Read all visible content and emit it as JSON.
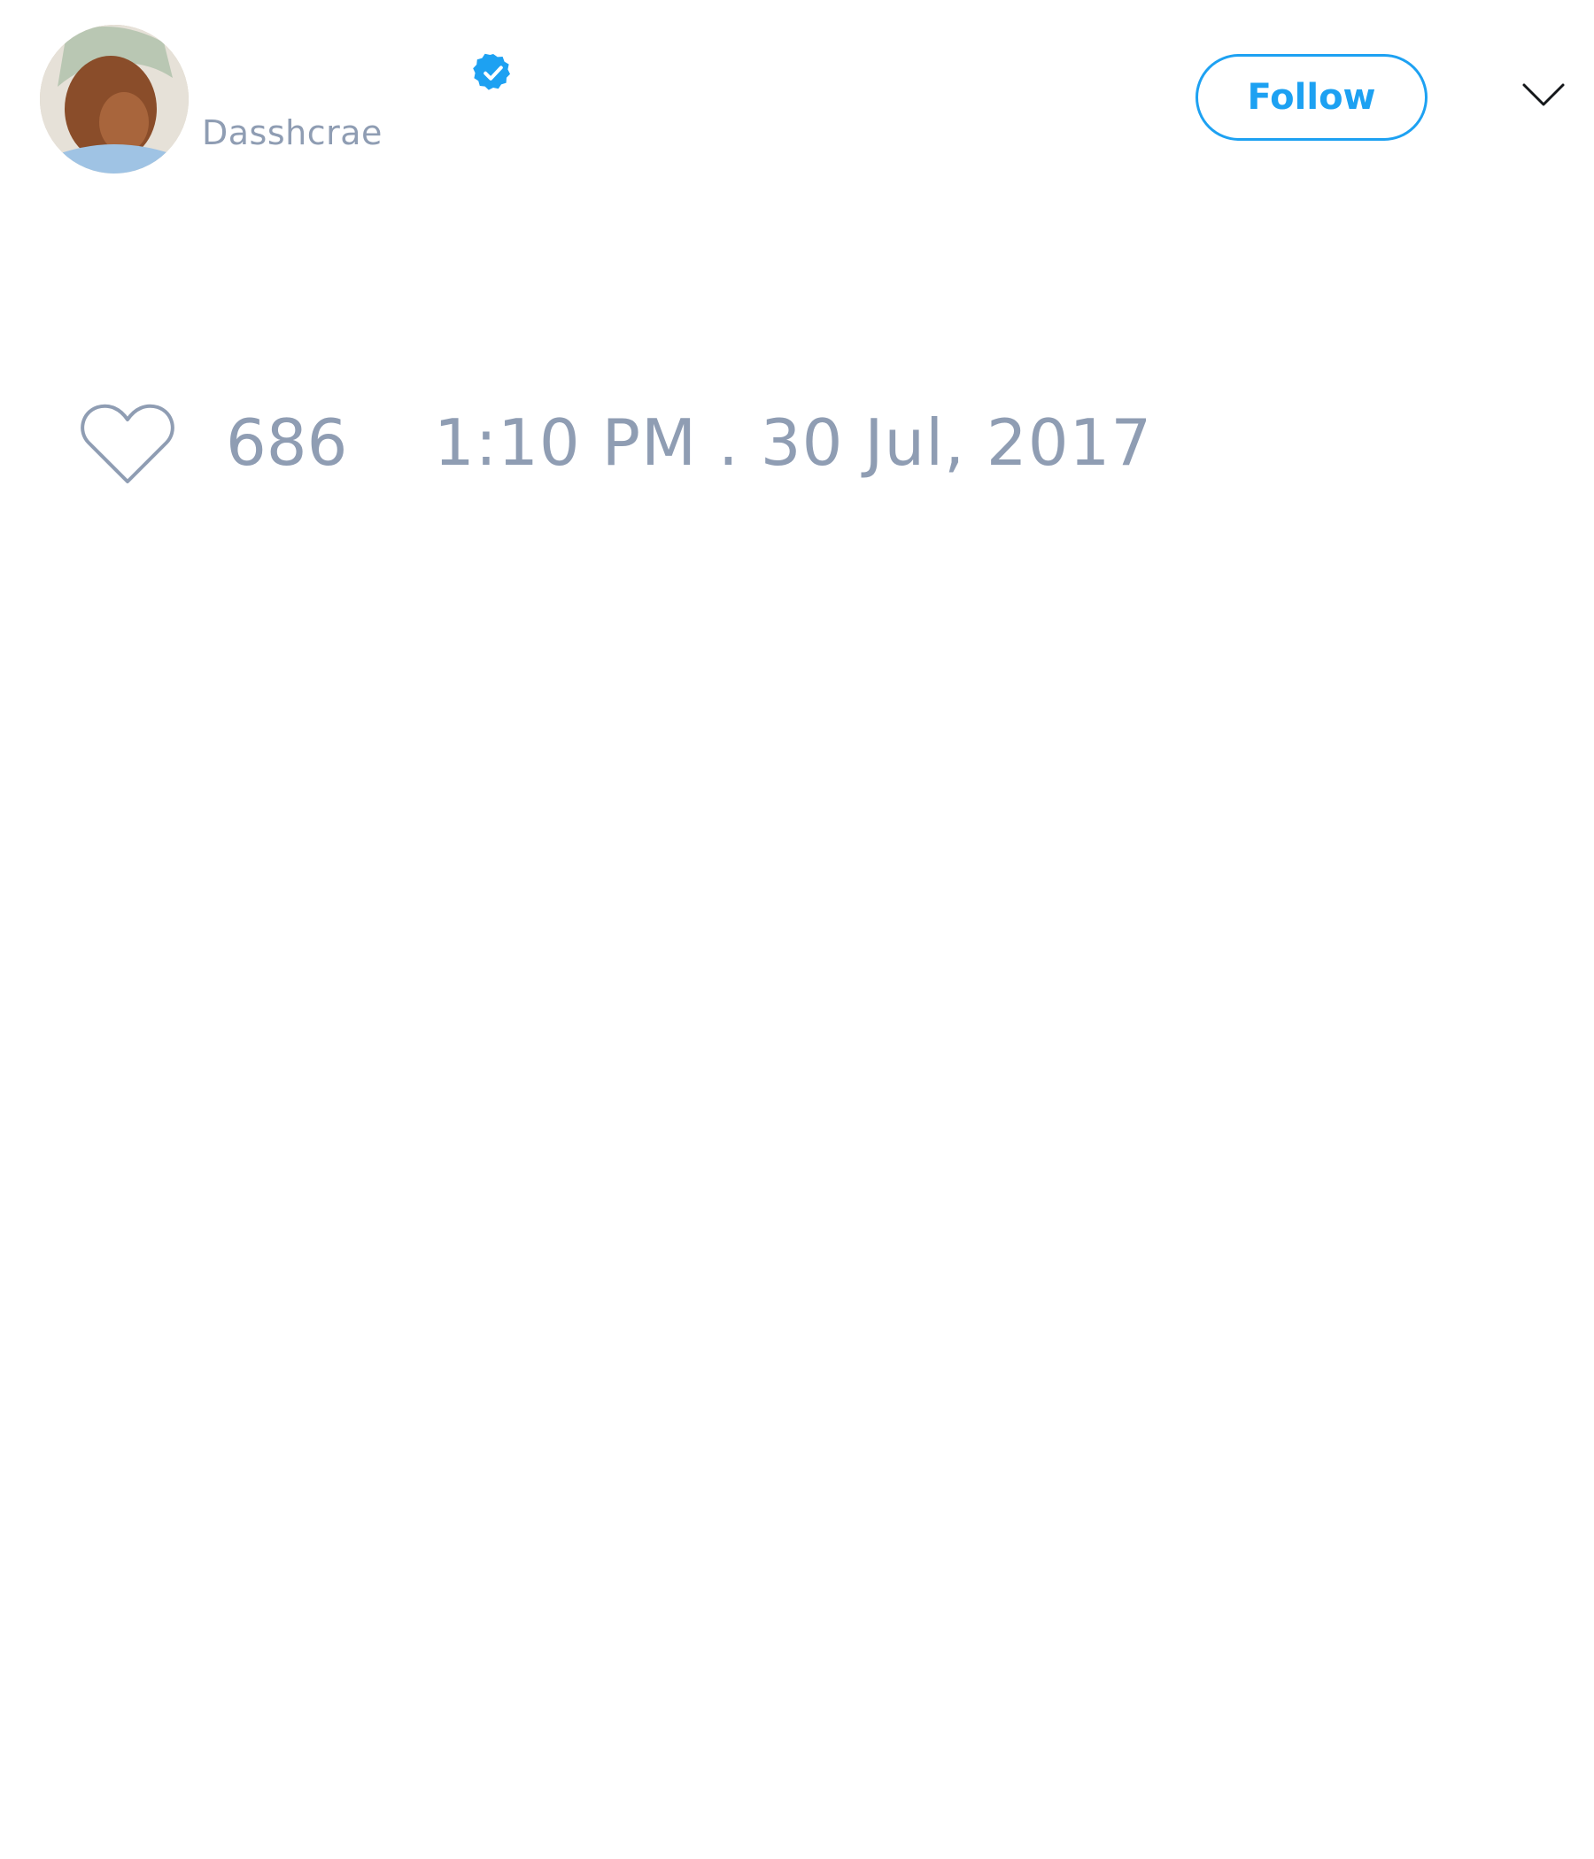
{
  "tweet": {
    "author": {
      "display_name": "",
      "username": "Dasshcrae",
      "verified_icon": "verified-badge-icon",
      "avatar_icon": "user-avatar"
    },
    "header": {
      "follow_label": "Follow",
      "menu_icon": "chevron-down-icon"
    },
    "footer": {
      "like_icon": "heart-outline-icon",
      "like_count": "686",
      "timestamp": "1:10 PM . 30 Jul, 2017"
    }
  },
  "colors": {
    "accent": "#1da1f2",
    "muted_text": "#8f9db3",
    "background": "#ffffff"
  }
}
